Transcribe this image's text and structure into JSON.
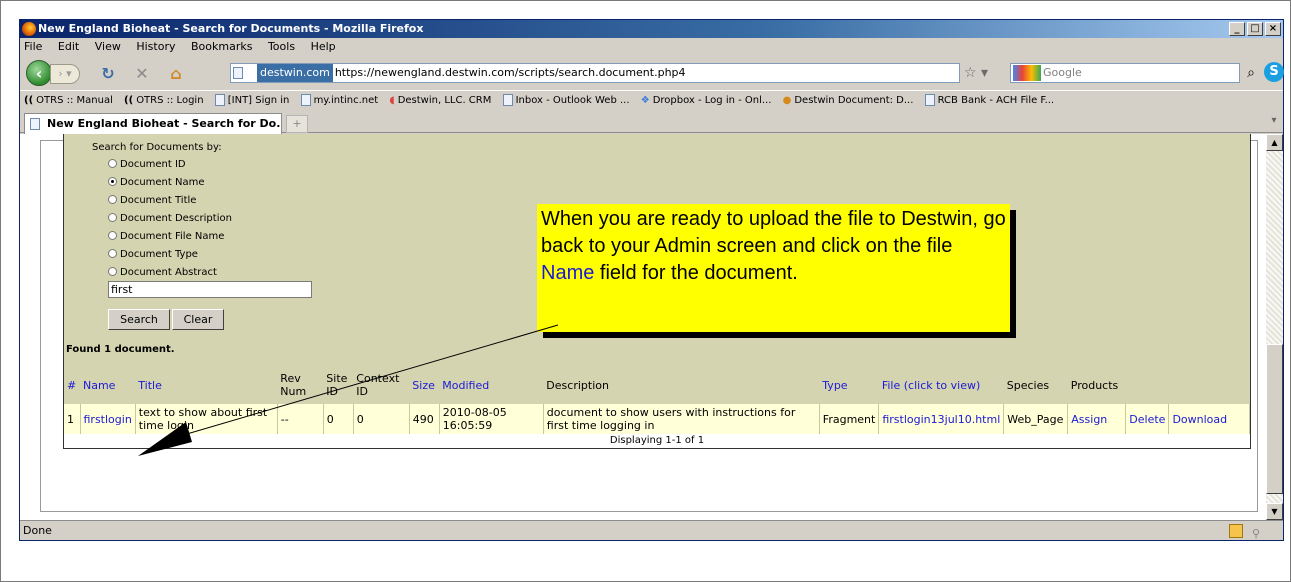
{
  "window": {
    "title": "New England Bioheat - Search for Documents - Mozilla Firefox",
    "controls": [
      "_",
      "□",
      "×"
    ]
  },
  "menu": [
    "File",
    "Edit",
    "View",
    "History",
    "Bookmarks",
    "Tools",
    "Help"
  ],
  "navbar": {
    "site_identity": "destwin.com",
    "url": "https://newengland.destwin.com/scripts/search.document.php4",
    "search_engine": "Google",
    "search_placeholder": "Google"
  },
  "bookmarks": [
    "OTRS :: Manual",
    "OTRS :: Login",
    "[INT] Sign in",
    "my.intinc.net",
    "Destwin, LLC. CRM",
    "Inbox - Outlook Web ...",
    "Dropbox - Log in - Onl...",
    "Destwin Document: D...",
    "RCB Bank - ACH File F..."
  ],
  "tab": {
    "title": "New England Bioheat - Search for Do...",
    "new_tab": "+"
  },
  "search_form": {
    "heading": "Search for Documents by:",
    "options": [
      "Document ID",
      "Document Name",
      "Document Title",
      "Document Description",
      "Document File Name",
      "Document Type",
      "Document Abstract"
    ],
    "selected": "Document Name",
    "query": "first",
    "search_button": "Search",
    "clear_button": "Clear"
  },
  "results": {
    "summary": "Found 1 document.",
    "columns": [
      "#",
      "Name",
      "Title",
      "Rev Num",
      "Site ID",
      "Context ID",
      "Size",
      "Modified",
      "Description",
      "Type",
      "File (click to view)",
      "Species",
      "Products",
      "",
      ""
    ],
    "row": {
      "num": "1",
      "name": "firstlogin",
      "title": "text to show about first time login",
      "rev": "--",
      "site_id": "0",
      "context_id": "0",
      "size": "490",
      "modified": "2010-08-05 16:05:59",
      "description": "document to show users with instructions for first time logging in",
      "type": "Fragment",
      "file": "firstlogin13jul10.html",
      "species": "Web_Page",
      "products": "Assign",
      "delete": "Delete",
      "download": "Download"
    },
    "displaying": "Displaying 1-1 of 1"
  },
  "callout": {
    "text_before": "When you are ready to upload the file to Destwin, go back to your Admin screen and click on the file ",
    "highlight": "Name",
    "text_after": " field for the document."
  },
  "status": "Done"
}
